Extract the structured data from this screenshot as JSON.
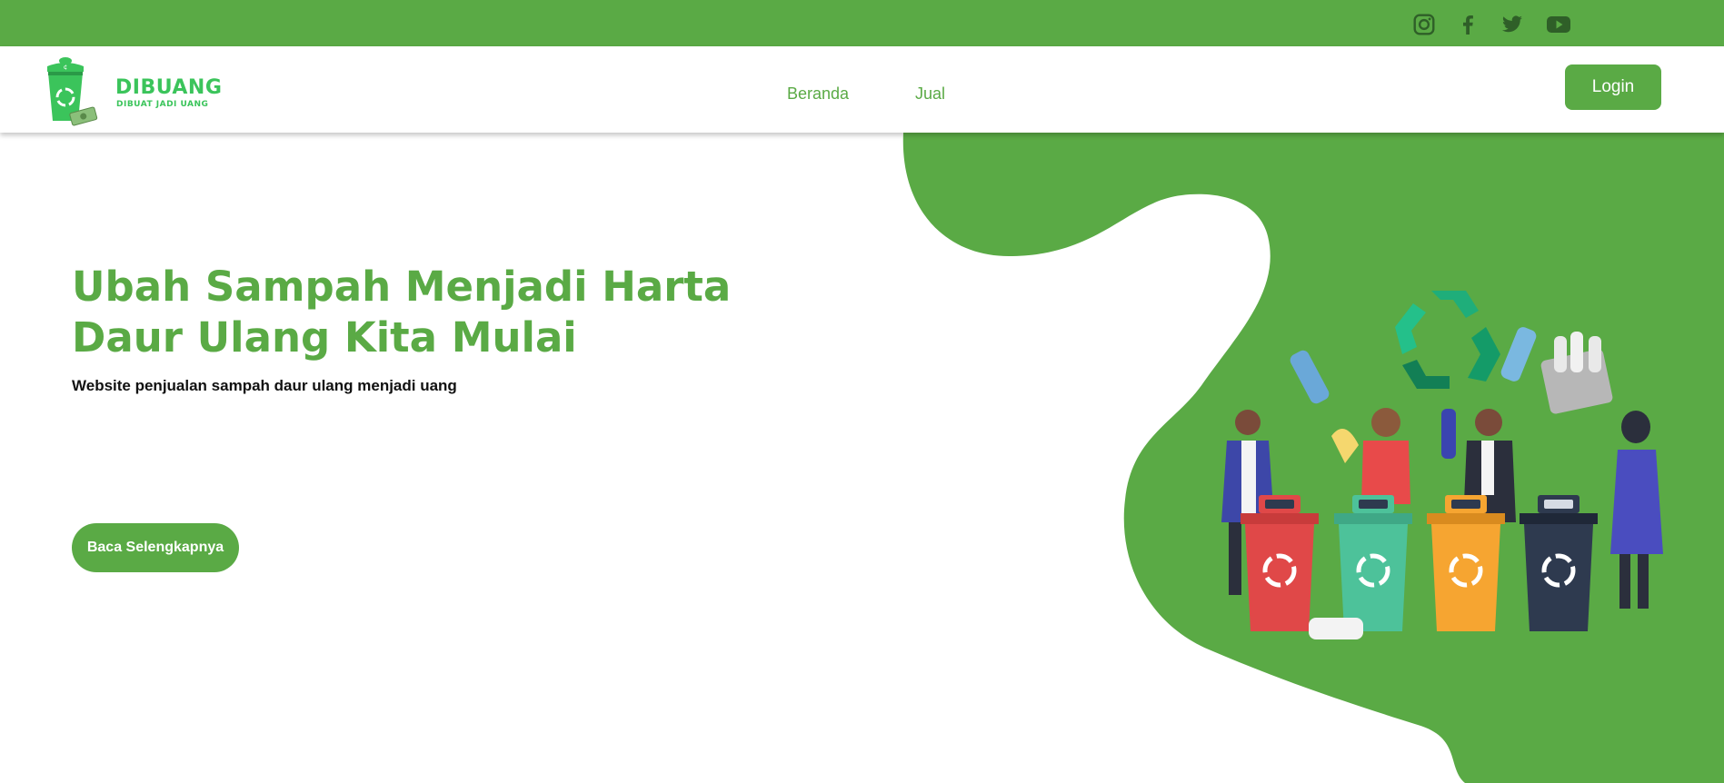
{
  "social": {
    "icons": [
      "instagram-icon",
      "facebook-icon",
      "twitter-icon",
      "youtube-icon"
    ],
    "color": "#2f5f28"
  },
  "brand": {
    "name": "DIBUANG",
    "tagline": "DIBUAT JADI UANG",
    "color": "#3bc45b"
  },
  "nav": {
    "items": [
      {
        "label": "Beranda"
      },
      {
        "label": "Jual"
      }
    ],
    "login_label": "Login"
  },
  "hero": {
    "title_line1": "Ubah Sampah Menjadi Harta",
    "title_line2": "Daur Ulang Kita Mulai",
    "subtitle": "Website penjualan sampah daur ulang menjadi uang",
    "cta_label": "Baca Selengkapnya"
  },
  "theme": {
    "primary": "#5aaa45",
    "bin_colors": [
      "#e04848",
      "#4dc29a",
      "#f6a531",
      "#2e3a4f"
    ]
  }
}
